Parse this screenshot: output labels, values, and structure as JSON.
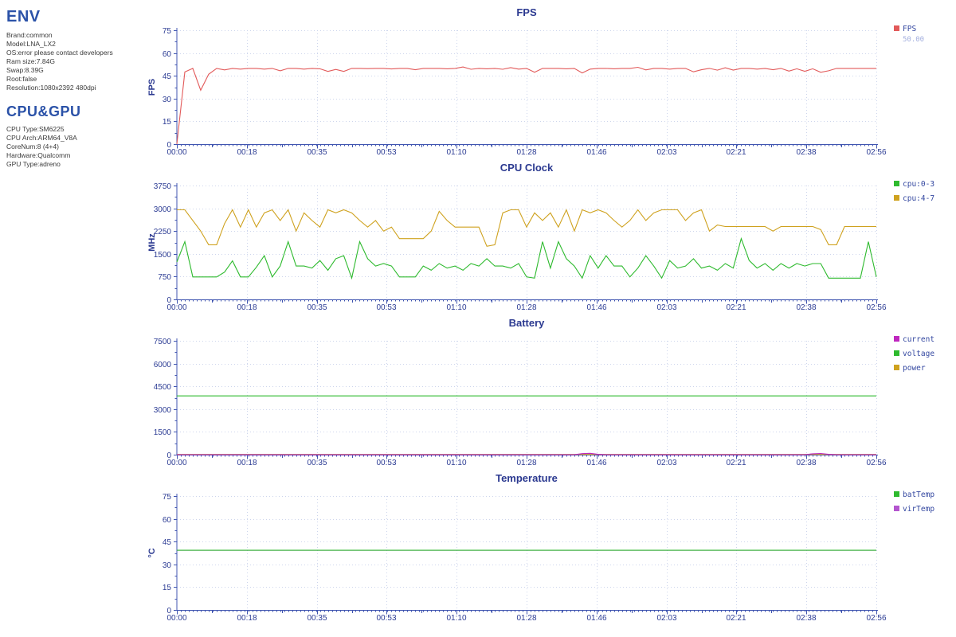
{
  "sidebar": {
    "env_title": "ENV",
    "env_lines": [
      "Brand:common",
      "Model:LNA_LX2",
      "OS:error please contact developers",
      "Ram size:7.84G",
      "Swap:8.39G",
      "Root:false",
      "Resolution:1080x2392 480dpi"
    ],
    "cpugpu_title": "CPU&GPU",
    "cpugpu_lines": [
      "CPU Type:SM6225",
      "CPU Arch:ARM64_V8A",
      "CoreNum:8 (4+4)",
      "Hardware:Qualcomm",
      "GPU Type:adreno"
    ]
  },
  "colors": {
    "title": "#2b3990",
    "axis": "#4055b0",
    "tick_label": "#2c3c94",
    "grid": "#cdd5ec",
    "legend_text": "#3347a0",
    "legend_sub": "#a2aede"
  },
  "chart_data": [
    {
      "type": "line",
      "title": "FPS",
      "ylabel": "FPS",
      "ymax": 75,
      "yticks": [
        0,
        15,
        30,
        45,
        60,
        75
      ],
      "xticks": [
        "00:00",
        "00:18",
        "00:35",
        "00:53",
        "01:10",
        "01:28",
        "01:46",
        "02:03",
        "02:21",
        "02:38",
        "02:56"
      ],
      "x_range_seconds": [
        0,
        176
      ],
      "grid": true,
      "legend_position": "right",
      "series": [
        {
          "name": "FPS",
          "color": "#e25a5a",
          "legend_sub": "50.00",
          "values": [
            0,
            47.5,
            49.9,
            35.5,
            46,
            49.9,
            48.9,
            49.9,
            49.4,
            49.9,
            49.9,
            49.4,
            49.9,
            48.3,
            49.9,
            49.9,
            49.4,
            49.9,
            49.6,
            47.9,
            49.2,
            47.9,
            49.9,
            49.9,
            49.7,
            49.9,
            49.9,
            49.5,
            49.9,
            49.9,
            49,
            49.9,
            49.9,
            49.9,
            49.6,
            49.9,
            50.8,
            49.3,
            49.9,
            49.6,
            49.9,
            49.3,
            50.4,
            49.4,
            49.9,
            47.3,
            49.9,
            49.9,
            49.9,
            49.6,
            49.9,
            46.9,
            49.4,
            49.9,
            49.9,
            49.6,
            49.9,
            49.9,
            50.6,
            48.9,
            49.9,
            49.9,
            49.4,
            49.9,
            49.9,
            47.6,
            49,
            49.9,
            48.7,
            50.3,
            48.8,
            49.9,
            49.9,
            49.4,
            49.9,
            49,
            49.9,
            48.1,
            49.6,
            48,
            49.6,
            47.3,
            48.3,
            49.9,
            49.9,
            49.9,
            49.9,
            49.9,
            49.9
          ]
        }
      ]
    },
    {
      "type": "line",
      "title": "CPU Clock",
      "ylabel": "MHz",
      "ymax": 3750,
      "yticks": [
        0,
        750,
        1500,
        2250,
        3000,
        3750
      ],
      "xticks": [
        "00:00",
        "00:18",
        "00:35",
        "00:53",
        "01:10",
        "01:28",
        "01:46",
        "02:03",
        "02:21",
        "02:38",
        "02:56"
      ],
      "x_range_seconds": [
        0,
        176
      ],
      "grid": true,
      "legend_position": "right",
      "series": [
        {
          "name": "cpu:0-3",
          "color": "#2eba2e",
          "values": [
            1230,
            1900,
            740,
            740,
            740,
            740,
            900,
            1270,
            740,
            740,
            1060,
            1440,
            740,
            1100,
            1900,
            1100,
            1100,
            1030,
            1280,
            960,
            1340,
            1440,
            700,
            1900,
            1340,
            1100,
            1180,
            1100,
            740,
            740,
            740,
            1100,
            960,
            1180,
            1030,
            1100,
            960,
            1180,
            1100,
            1340,
            1100,
            1100,
            1030,
            1180,
            740,
            700,
            1900,
            1030,
            1900,
            1340,
            1100,
            700,
            1440,
            1030,
            1440,
            1100,
            1100,
            740,
            1030,
            1440,
            1100,
            700,
            1280,
            1030,
            1100,
            1340,
            1030,
            1100,
            960,
            1180,
            1030,
            2000,
            1280,
            1030,
            1180,
            960,
            1180,
            1030,
            1180,
            1100,
            1180,
            1180,
            700,
            700,
            700,
            700,
            700,
            1900,
            740
          ]
        },
        {
          "name": "cpu:4-7",
          "color": "#cfa21f",
          "values": [
            2950,
            2950,
            2600,
            2250,
            1800,
            1800,
            2500,
            2950,
            2380,
            2950,
            2380,
            2850,
            2950,
            2600,
            2950,
            2250,
            2850,
            2600,
            2380,
            2950,
            2850,
            2950,
            2850,
            2600,
            2380,
            2600,
            2250,
            2380,
            2000,
            2000,
            2000,
            2000,
            2250,
            2900,
            2600,
            2380,
            2380,
            2380,
            2380,
            1750,
            1800,
            2850,
            2950,
            2950,
            2380,
            2850,
            2600,
            2850,
            2380,
            2950,
            2250,
            2950,
            2850,
            2950,
            2850,
            2600,
            2380,
            2600,
            2950,
            2600,
            2850,
            2950,
            2950,
            2950,
            2600,
            2850,
            2950,
            2250,
            2450,
            2400,
            2400,
            2400,
            2400,
            2400,
            2400,
            2250,
            2400,
            2400,
            2400,
            2400,
            2400,
            2300,
            1800,
            1800,
            2400,
            2400,
            2400,
            2400,
            2400
          ]
        }
      ]
    },
    {
      "type": "line",
      "title": "Battery",
      "ylabel": "",
      "ymax": 7500,
      "yticks": [
        0,
        1500,
        3000,
        4500,
        6000,
        7500
      ],
      "xticks": [
        "00:00",
        "00:18",
        "00:35",
        "00:53",
        "01:10",
        "01:28",
        "01:46",
        "02:03",
        "02:21",
        "02:38",
        "02:56"
      ],
      "x_range_seconds": [
        0,
        176
      ],
      "grid": true,
      "legend_position": "right",
      "series": [
        {
          "name": "current",
          "color": "#bf27bf",
          "values": [
            0,
            0,
            0,
            0,
            0,
            0,
            0,
            0,
            0,
            0,
            0,
            0,
            0,
            0,
            0,
            0,
            0,
            0,
            0,
            0,
            0,
            0,
            0,
            0,
            0,
            0,
            0,
            0,
            0,
            0,
            0,
            0,
            0,
            0,
            0,
            0,
            0,
            0,
            0,
            0,
            0,
            0,
            0,
            0,
            0,
            0,
            0,
            0,
            0,
            0,
            0,
            70,
            90,
            20,
            0,
            0,
            0,
            0,
            0,
            0,
            0,
            0,
            0,
            0,
            0,
            0,
            0,
            0,
            0,
            0,
            0,
            0,
            0,
            0,
            0,
            0,
            0,
            0,
            0,
            0,
            60,
            80,
            20,
            0,
            0,
            0,
            0,
            0,
            0
          ]
        },
        {
          "name": "voltage",
          "color": "#2eba2e",
          "values": [
            3870,
            3870
          ]
        },
        {
          "name": "power",
          "color": "#cfa21f",
          "values": [
            15,
            15
          ]
        }
      ]
    },
    {
      "type": "line",
      "title": "Temperature",
      "ylabel": "°C",
      "ymax": 75,
      "yticks": [
        0,
        15,
        30,
        45,
        60,
        75
      ],
      "xticks": [
        "00:00",
        "00:18",
        "00:35",
        "00:53",
        "01:10",
        "01:28",
        "01:46",
        "02:03",
        "02:21",
        "02:38",
        "02:56"
      ],
      "x_range_seconds": [
        0,
        176
      ],
      "grid": true,
      "legend_position": "right",
      "series": [
        {
          "name": "batTemp",
          "color": "#2eba2e",
          "values": [
            39.3,
            39.3
          ]
        },
        {
          "name": "virTemp",
          "color": "#b455cf",
          "values": [
            39.3,
            39.3
          ]
        }
      ]
    }
  ]
}
